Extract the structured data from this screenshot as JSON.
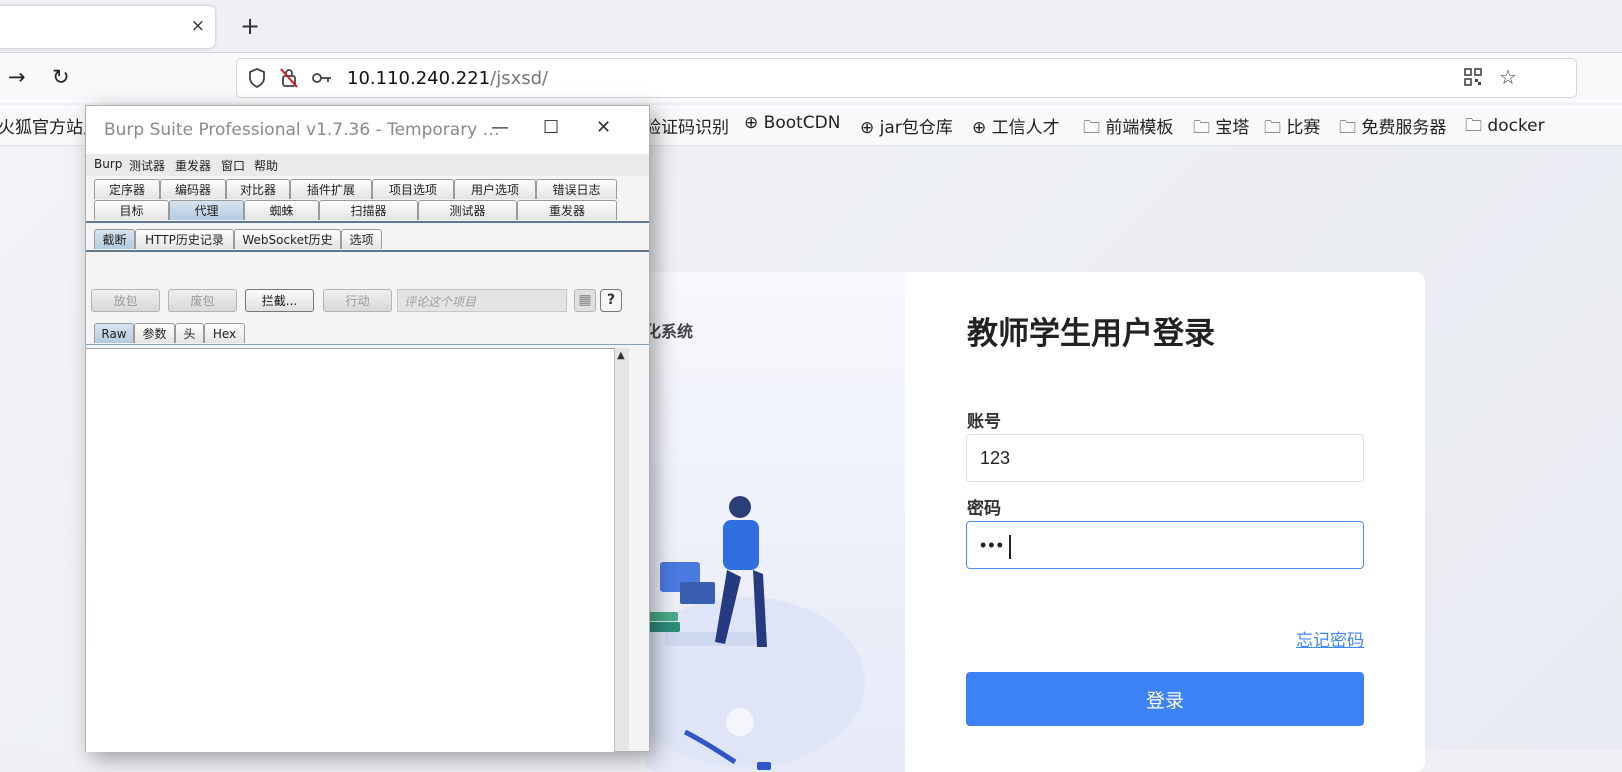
{
  "browser": {
    "tab": {
      "title": "",
      "close": "×"
    },
    "new_tab": "+",
    "nav": {
      "forward": "→",
      "reload": "↻"
    },
    "url": {
      "host": "10.110.240.221",
      "path": "/jsxsd/"
    },
    "bookmarks": [
      {
        "icon": "",
        "label": "火狐官方站点"
      },
      {
        "icon": "",
        "label": "验证码识别"
      },
      {
        "icon": "globe-icon",
        "label": "BootCDN"
      },
      {
        "icon": "globe-icon",
        "label": "jar包仓库"
      },
      {
        "icon": "globe-icon",
        "label": "工信人才"
      },
      {
        "icon": "folder-icon",
        "label": "前端模板"
      },
      {
        "icon": "folder-icon",
        "label": "宝塔"
      },
      {
        "icon": "folder-icon",
        "label": "比赛"
      },
      {
        "icon": "folder-icon",
        "label": "免费服务器"
      },
      {
        "icon": "folder-icon",
        "label": "docker"
      }
    ]
  },
  "login": {
    "system_name_fragment": "化系统",
    "title": "教师学生用户登录",
    "account_label": "账号",
    "account_value": "123",
    "password_label": "密码",
    "password_value": "•••",
    "forgot": "忘记密码",
    "submit": "登录",
    "accent_color": "#3d82f6"
  },
  "burp": {
    "title": "Burp Suite Professional v1.7.36 - Temporary …",
    "window_buttons": {
      "minimize": "—",
      "maximize": "☐",
      "close": "✕"
    },
    "menu": [
      "Burp",
      "测试器",
      "重发器",
      "窗口",
      "帮助"
    ],
    "tabs_row1": [
      "定序器",
      "编码器",
      "对比器",
      "插件扩展",
      "项目选项",
      "用户选项",
      "错误日志"
    ],
    "tabs_row2": [
      "目标",
      "代理",
      "蜘蛛",
      "扫描器",
      "测试器",
      "重发器"
    ],
    "active_tab": "代理",
    "subtabs": [
      "截断",
      "HTTP历史记录",
      "WebSocket历史",
      "选项"
    ],
    "active_subtab": "截断",
    "actions": {
      "forward": "放包",
      "drop": "废包",
      "intercept": "拦截...",
      "action": "行动"
    },
    "comment_placeholder": "评论这个项目",
    "help": "?",
    "view_tabs": [
      "Raw",
      "参数",
      "头",
      "Hex"
    ],
    "active_view": "Raw"
  }
}
